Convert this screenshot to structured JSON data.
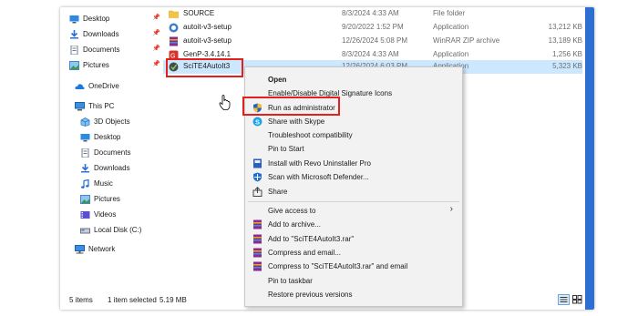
{
  "sidebar": {
    "items": [
      {
        "label": "Desktop",
        "icon": "desktop-icon",
        "pinned": true
      },
      {
        "label": "Downloads",
        "icon": "download-icon",
        "pinned": true
      },
      {
        "label": "Documents",
        "icon": "documents-icon",
        "pinned": true
      },
      {
        "label": "Pictures",
        "icon": "pictures-icon",
        "pinned": true
      },
      {
        "label": "OneDrive",
        "icon": "cloud-icon"
      },
      {
        "label": "This PC",
        "icon": "computer-icon"
      },
      {
        "label": "3D Objects",
        "icon": "cube-icon"
      },
      {
        "label": "Desktop",
        "icon": "desktop-icon"
      },
      {
        "label": "Documents",
        "icon": "documents-icon"
      },
      {
        "label": "Downloads",
        "icon": "download-icon"
      },
      {
        "label": "Music",
        "icon": "music-icon"
      },
      {
        "label": "Pictures",
        "icon": "pictures-icon"
      },
      {
        "label": "Videos",
        "icon": "video-icon"
      },
      {
        "label": "Local Disk (C:)",
        "icon": "drive-icon"
      },
      {
        "label": "Network",
        "icon": "network-icon"
      }
    ]
  },
  "files": [
    {
      "name": "SOURCE",
      "date": "8/3/2024 4:33 AM",
      "type": "File folder",
      "size": "",
      "icon": "folder-icon"
    },
    {
      "name": "autoit-v3-setup",
      "date": "9/20/2022 1:52 PM",
      "type": "Application",
      "size": "13,212 KB",
      "icon": "app-icon"
    },
    {
      "name": "autoit-v3-setup",
      "date": "12/26/2024 5:08 PM",
      "type": "WinRAR ZIP archive",
      "size": "13,189 KB",
      "icon": "archive-icon"
    },
    {
      "name": "GenP-3.4.14.1",
      "date": "8/3/2024 4:33 AM",
      "type": "Application",
      "size": "1,256 KB",
      "icon": "app-icon"
    },
    {
      "name": "SciTE4AutoIt3",
      "date": "12/26/2024 6:03 PM",
      "type": "Application",
      "size": "5,323 KB",
      "icon": "app-icon",
      "selected": true
    }
  ],
  "context_menu": {
    "items": [
      {
        "label": "Open",
        "bold": true
      },
      {
        "label": "Enable/Disable Digital Signature Icons"
      },
      {
        "label": "Run as administrator",
        "icon": "shield-icon"
      },
      {
        "label": "Share with Skype",
        "icon": "skype-icon"
      },
      {
        "label": "Troubleshoot compatibility"
      },
      {
        "label": "Pin to Start"
      },
      {
        "label": "Install with Revo Uninstaller Pro",
        "icon": "revo-icon"
      },
      {
        "label": "Scan with Microsoft Defender...",
        "icon": "defender-icon"
      },
      {
        "label": "Share",
        "icon": "share-icon"
      },
      {
        "label": "Give access to",
        "submenu": true
      },
      {
        "label": "Add to archive...",
        "icon": "winrar-icon"
      },
      {
        "label": "Add to \"SciTE4AutoIt3.rar\"",
        "icon": "winrar-icon"
      },
      {
        "label": "Compress and email...",
        "icon": "winrar-icon"
      },
      {
        "label": "Compress to \"SciTE4AutoIt3.rar\" and email",
        "icon": "winrar-icon"
      },
      {
        "label": "Pin to taskbar"
      },
      {
        "label": "Restore previous versions"
      }
    ]
  },
  "status": {
    "items_count": "5 items",
    "selected": "1 item selected",
    "size": "5.19 MB"
  },
  "colors": {
    "accent": "#2d6fd0",
    "selection": "#cce8ff",
    "highlight_box": "#e2211c",
    "menu_bg": "#f2f2f2"
  }
}
